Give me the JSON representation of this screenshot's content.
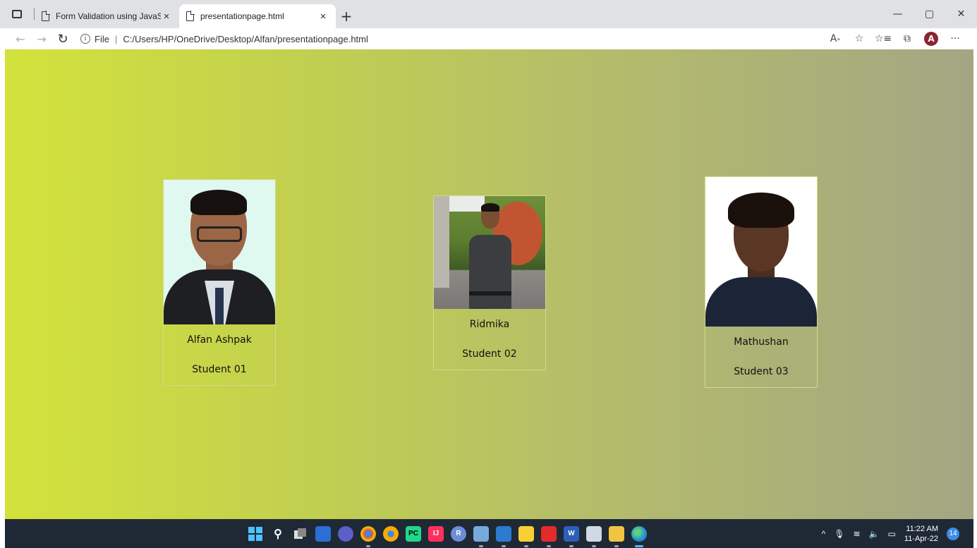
{
  "browser": {
    "tabs": [
      {
        "title": "Form Validation using JavaScript",
        "active": false
      },
      {
        "title": "presentationpage.html",
        "active": true
      }
    ],
    "new_tab_symbol": "+",
    "close_symbol": "×",
    "address": {
      "protocol_label": "File",
      "separator": "|",
      "url": "C:/Users/HP/OneDrive/Desktop/Alfan/presentationpage.html"
    },
    "profile_initial": "A",
    "more_symbol": "···",
    "window_controls": {
      "minimize": "—",
      "maximize": "▢",
      "close": "✕"
    }
  },
  "students": [
    {
      "name": "Alfan Ashpak",
      "role": "Student 01"
    },
    {
      "name": "Ridmika",
      "role": "Student 02"
    },
    {
      "name": "Mathushan",
      "role": "Student 03"
    }
  ],
  "taskbar": {
    "time": "11:22 AM",
    "date": "11-Apr-22",
    "notification_count": "14",
    "icons": [
      "start-icon",
      "search-icon",
      "task-view-icon",
      "widgets-icon",
      "chat-icon",
      "chrome-icon",
      "chrome-canary-icon",
      "pycharm-icon",
      "intellij-icon",
      "r-icon",
      "rstudio-icon",
      "photos-icon",
      "sticky-notes-icon",
      "acrobat-icon",
      "word-icon",
      "snipping-tool-icon",
      "file-explorer-icon",
      "edge-icon"
    ]
  },
  "colors": {
    "page_gradient_start": "#d3e23b",
    "page_gradient_end": "#a3a683",
    "taskbar": "#1f2935",
    "profile": "#8a2531"
  }
}
